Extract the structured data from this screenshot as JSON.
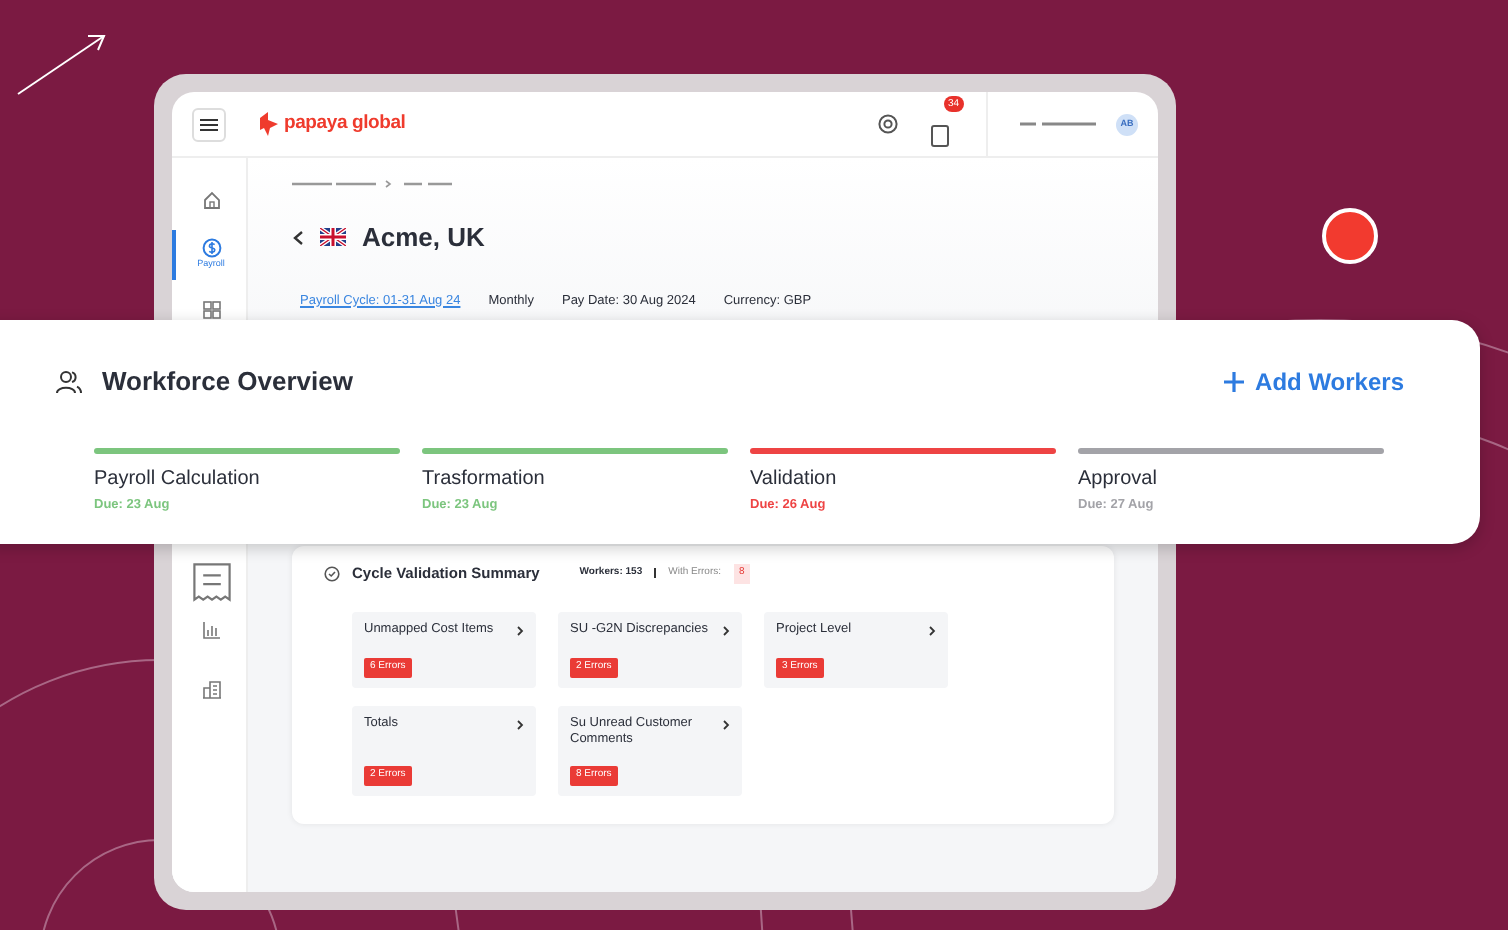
{
  "app": {
    "logo_text": "papaya global",
    "notification_count": "34",
    "avatar_initials": "AB"
  },
  "sidebar": {
    "items": [
      {
        "kind": "home",
        "selected": false
      },
      {
        "kind": "payroll",
        "label": "Payroll",
        "selected": true
      },
      {
        "kind": "grid",
        "selected": false
      },
      {
        "kind": "receipt",
        "selected": false
      },
      {
        "kind": "chart",
        "selected": false
      },
      {
        "kind": "building",
        "selected": false
      }
    ]
  },
  "page": {
    "title": "Acme, UK",
    "meta": [
      {
        "kind": "link",
        "text": "Payroll Cycle: 01-31 Aug 24"
      },
      {
        "kind": "plain",
        "text": "Monthly"
      },
      {
        "kind": "plain",
        "text": "Pay Date: 30 Aug 2024"
      },
      {
        "kind": "plain",
        "text": "Currency: GBP"
      }
    ]
  },
  "workforce": {
    "title": "Workforce Overview",
    "action": "Add Workers",
    "stages": [
      {
        "name": "Payroll Calculation",
        "due": "Due: 23 Aug",
        "color": "#7cc57e"
      },
      {
        "name": "Trasformation",
        "due": "Due: 23 Aug",
        "color": "#7cc57e"
      },
      {
        "name": "Validation",
        "due": "Due: 26 Aug",
        "color": "#ee4444"
      },
      {
        "name": "Approval",
        "due": "Due: 27 Aug",
        "color": "#a3a3a8"
      }
    ]
  },
  "summary": {
    "title": "Cycle Validation Summary",
    "workers": "Workers: 153",
    "with_errors_label": "With Errors:",
    "with_errors_count": "8",
    "tiles": [
      {
        "name": "Unmapped Cost Items",
        "errors": "6 Errors"
      },
      {
        "name": "SU -G2N Discrepancies",
        "errors": "2 Errors"
      },
      {
        "name": "Project Level",
        "errors": "3 Errors"
      },
      {
        "name": "Totals",
        "errors": "2 Errors"
      },
      {
        "name": "Su Unread Customer Comments",
        "errors": "8 Errors"
      }
    ]
  }
}
